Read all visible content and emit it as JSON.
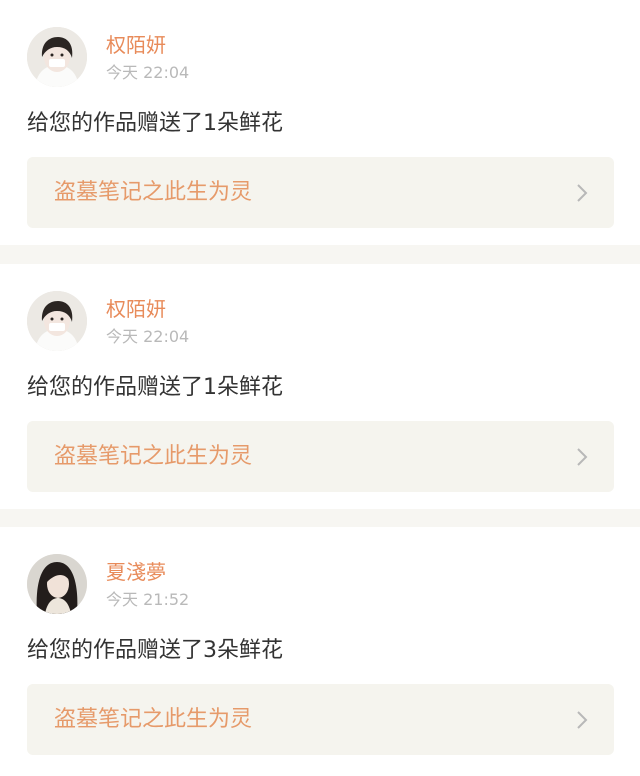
{
  "notifications": [
    {
      "username": "权陌妍",
      "time": "今天 22:04",
      "message": "给您的作品赠送了1朵鲜花",
      "work_title": "盗墓笔记之此生为灵",
      "avatar": "avatar-girl-bangs"
    },
    {
      "username": "权陌妍",
      "time": "今天 22:04",
      "message": "给您的作品赠送了1朵鲜花",
      "work_title": "盗墓笔记之此生为灵",
      "avatar": "avatar-girl-bangs"
    },
    {
      "username": "夏淺夢",
      "time": "今天 21:52",
      "message": "给您的作品赠送了3朵鲜花",
      "work_title": "盗墓笔记之此生为灵",
      "avatar": "avatar-girl-long-hair"
    }
  ],
  "colors": {
    "username": "#e88b5a",
    "work_title": "#e69a6a",
    "time": "#b9b9b9",
    "message": "#333333",
    "card_bg": "#ffffff",
    "separator": "#f7f6f2",
    "link_bg": "#f5f4ee"
  },
  "icons": {
    "chevron": "chevron-right-icon"
  }
}
